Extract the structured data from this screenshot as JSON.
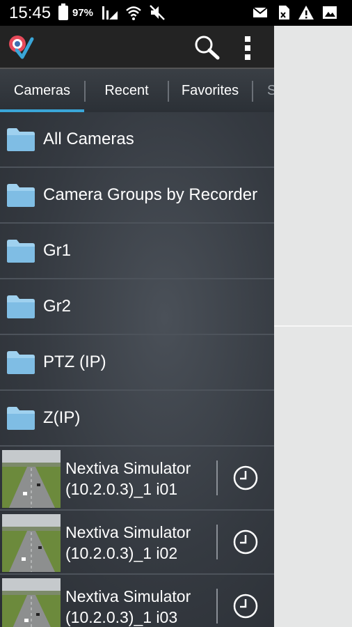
{
  "status_bar": {
    "time": "15:45",
    "battery_percent": "97%"
  },
  "app_bar": {
    "logo": "app-logo-icon",
    "search_icon": "search-icon",
    "menu_icon": "more-vert-icon"
  },
  "tabs": [
    {
      "label": "Cameras",
      "active": true
    },
    {
      "label": "Recent",
      "active": false
    },
    {
      "label": "Favorites",
      "active": false
    },
    {
      "label": "S",
      "active": false
    }
  ],
  "folders": [
    {
      "label": "All Cameras"
    },
    {
      "label": "Camera Groups by Recorder"
    },
    {
      "label": "Gr1"
    },
    {
      "label": "Gr2"
    },
    {
      "label": "PTZ (IP)"
    },
    {
      "label": "Z(IP)"
    }
  ],
  "cameras": [
    {
      "line1": "Nextiva Simulator",
      "line2": "(10.2.0.3)_1 i01"
    },
    {
      "line1": "Nextiva Simulator",
      "line2": "(10.2.0.3)_1 i02"
    },
    {
      "line1": "Nextiva Simulator",
      "line2": "(10.2.0.3)_1 i03"
    }
  ],
  "colors": {
    "accent": "#3aa6d8",
    "folder": "#9fd1ef",
    "list_bg": "#353a41",
    "side_panel": "#e5e6e6"
  }
}
